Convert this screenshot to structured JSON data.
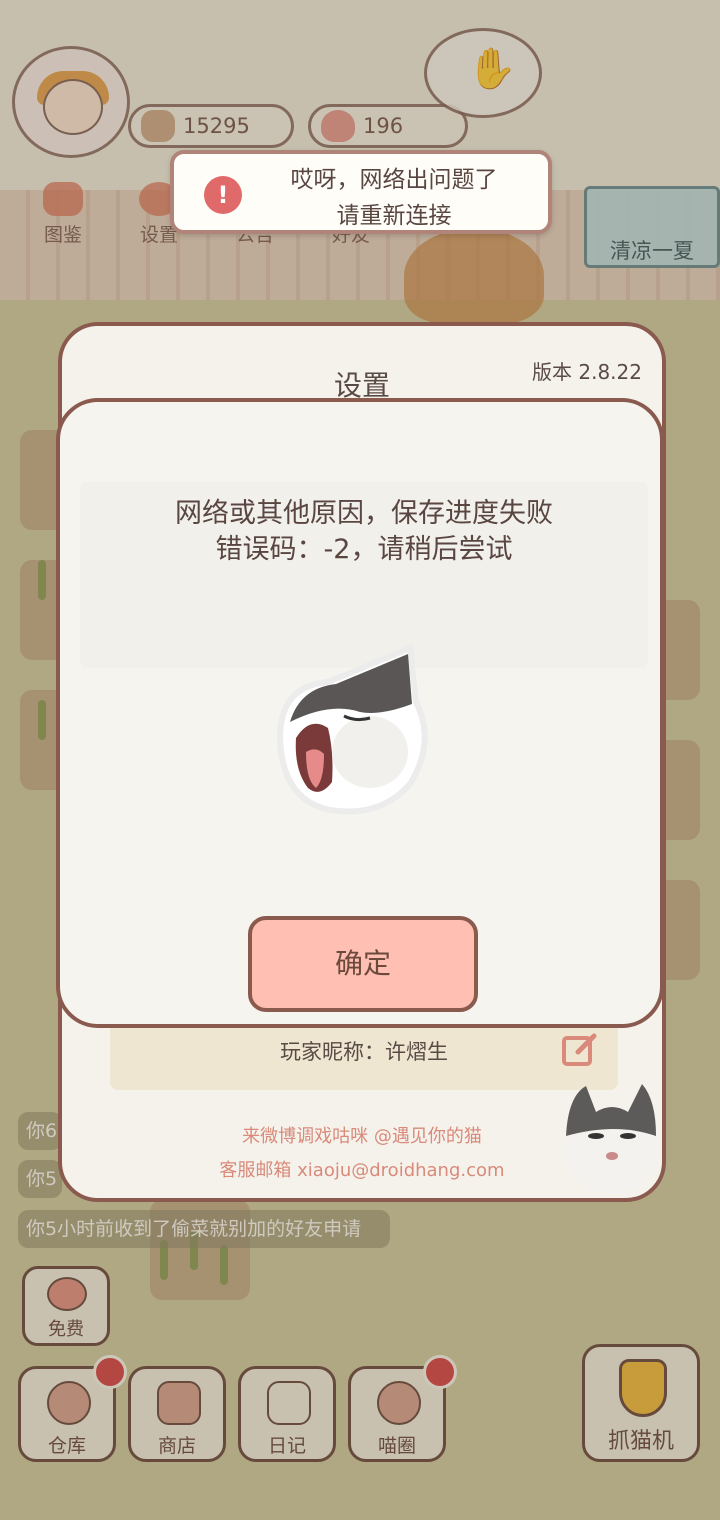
{
  "hud": {
    "coins": "15295",
    "hearts": "196"
  },
  "menu": {
    "items": [
      {
        "label": "图鉴",
        "icon": "cat-book-icon"
      },
      {
        "label": "设置",
        "icon": "gear-icon"
      },
      {
        "label": "公告",
        "icon": "notice-icon"
      },
      {
        "label": "好友",
        "icon": "friends-icon"
      }
    ]
  },
  "event_banner": {
    "label": "清凉一夏"
  },
  "chat": {
    "lines": [
      "你6",
      "你5",
      "你5小时前收到了偷菜就别加的好友申请"
    ]
  },
  "toolbar": {
    "free_label": "免费",
    "items": [
      {
        "label": "仓库",
        "icon": "warehouse-icon"
      },
      {
        "label": "商店",
        "icon": "shop-icon"
      },
      {
        "label": "日记",
        "icon": "diary-icon"
      },
      {
        "label": "喵圈",
        "icon": "cat-planet-icon"
      }
    ],
    "claw_label": "抓猫机"
  },
  "toast": {
    "line1": "哎呀，网络出问题了",
    "line2": "请重新连接",
    "icon": "!"
  },
  "settings": {
    "title": "设置",
    "version": "版本 2.8.22",
    "nickname": "玩家昵称：许熠生",
    "weibo": "来微博调戏咕咪 @遇见你的猫",
    "email": "客服邮箱 xiaoju@droidhang.com"
  },
  "dialog": {
    "line1": "网络或其他原因，保存进度失败",
    "line2": "错误码：-2，请稍后尝试",
    "ok_label": "确定"
  },
  "colors": {
    "dialog_border": "#8a5a4e",
    "ok_button": "#ffbfb2",
    "toast_icon": "#e06a6a",
    "link_text": "#d98a7a"
  }
}
